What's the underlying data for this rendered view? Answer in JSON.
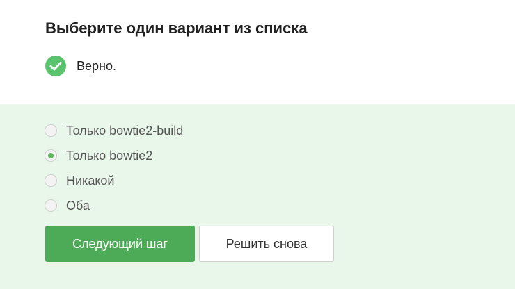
{
  "question": {
    "title": "Выберите один вариант из списка"
  },
  "feedback": {
    "icon": "check-circle-icon",
    "text": "Верно.",
    "color": "#59c46d"
  },
  "options": [
    {
      "label": "Только bowtie2-build",
      "selected": false
    },
    {
      "label": "Только bowtie2",
      "selected": true
    },
    {
      "label": "Никакой",
      "selected": false
    },
    {
      "label": "Оба",
      "selected": false
    }
  ],
  "buttons": {
    "next_label": "Следующий шаг",
    "retry_label": "Решить снова"
  },
  "colors": {
    "accent": "#4daa57",
    "answer_background": "#e9f6ea"
  }
}
